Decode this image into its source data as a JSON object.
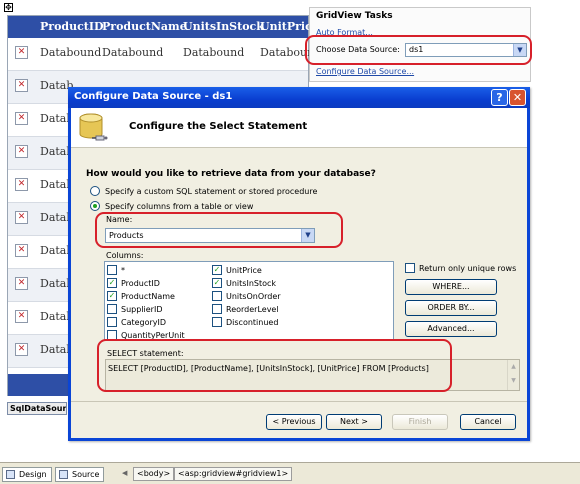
{
  "grid": {
    "headers": [
      "ProductID",
      "ProductName",
      "UnitsInStock",
      "UnitPrice"
    ],
    "first_row_cells": [
      "Databound",
      "Databound",
      "Databound",
      "Databound"
    ],
    "row_label": "Datab",
    "move_glyph": "✥",
    "check_glyph": "✕",
    "datasource_tag": "SqlDataSource"
  },
  "tasks": {
    "title": "GridView Tasks",
    "auto_format": "Auto Format...",
    "choose_label": "Choose Data Source:",
    "choose_value": "ds1",
    "configure_link": "Configure Data Source..."
  },
  "dialog": {
    "title": "Configure Data Source - ds1",
    "help_glyph": "?",
    "close_glyph": "✕",
    "header": "Configure the Select Statement",
    "question": "How would you like to retrieve data from your database?",
    "option_custom": "Specify a custom SQL statement or stored procedure",
    "option_columns": "Specify columns from a table or view",
    "name_label": "Name:",
    "name_value": "Products",
    "columns_label": "Columns:",
    "columns": [
      {
        "label": "*",
        "checked": false
      },
      {
        "label": "ProductID",
        "checked": true
      },
      {
        "label": "ProductName",
        "checked": true
      },
      {
        "label": "SupplierID",
        "checked": false
      },
      {
        "label": "CategoryID",
        "checked": false
      },
      {
        "label": "QuantityPerUnit",
        "checked": false
      },
      {
        "label": "UnitPrice",
        "checked": true
      },
      {
        "label": "UnitsInStock",
        "checked": true
      },
      {
        "label": "UnitsOnOrder",
        "checked": false
      },
      {
        "label": "ReorderLevel",
        "checked": false
      },
      {
        "label": "Discontinued",
        "checked": false
      }
    ],
    "unique_rows_label": "Return only unique rows",
    "where_button": "WHERE...",
    "orderby_button": "ORDER BY...",
    "advanced_button": "Advanced...",
    "select_label": "SELECT statement:",
    "select_statement": "SELECT [ProductID], [ProductName], [UnitsInStock], [UnitPrice] FROM [Products]",
    "previous_button": "< Previous",
    "next_button": "Next >",
    "finish_button": "Finish",
    "cancel_button": "Cancel"
  },
  "bottom_bar": {
    "design_tab": "Design",
    "source_tab": "Source",
    "crumb_body": "<body>",
    "crumb_gridview": "<asp:gridview#gridview1>"
  },
  "colors": {
    "grid_header": "#2e4fa6",
    "dialog_border": "#0a45d6",
    "highlight_oval": "#d7202a",
    "link": "#1f4aa8"
  }
}
